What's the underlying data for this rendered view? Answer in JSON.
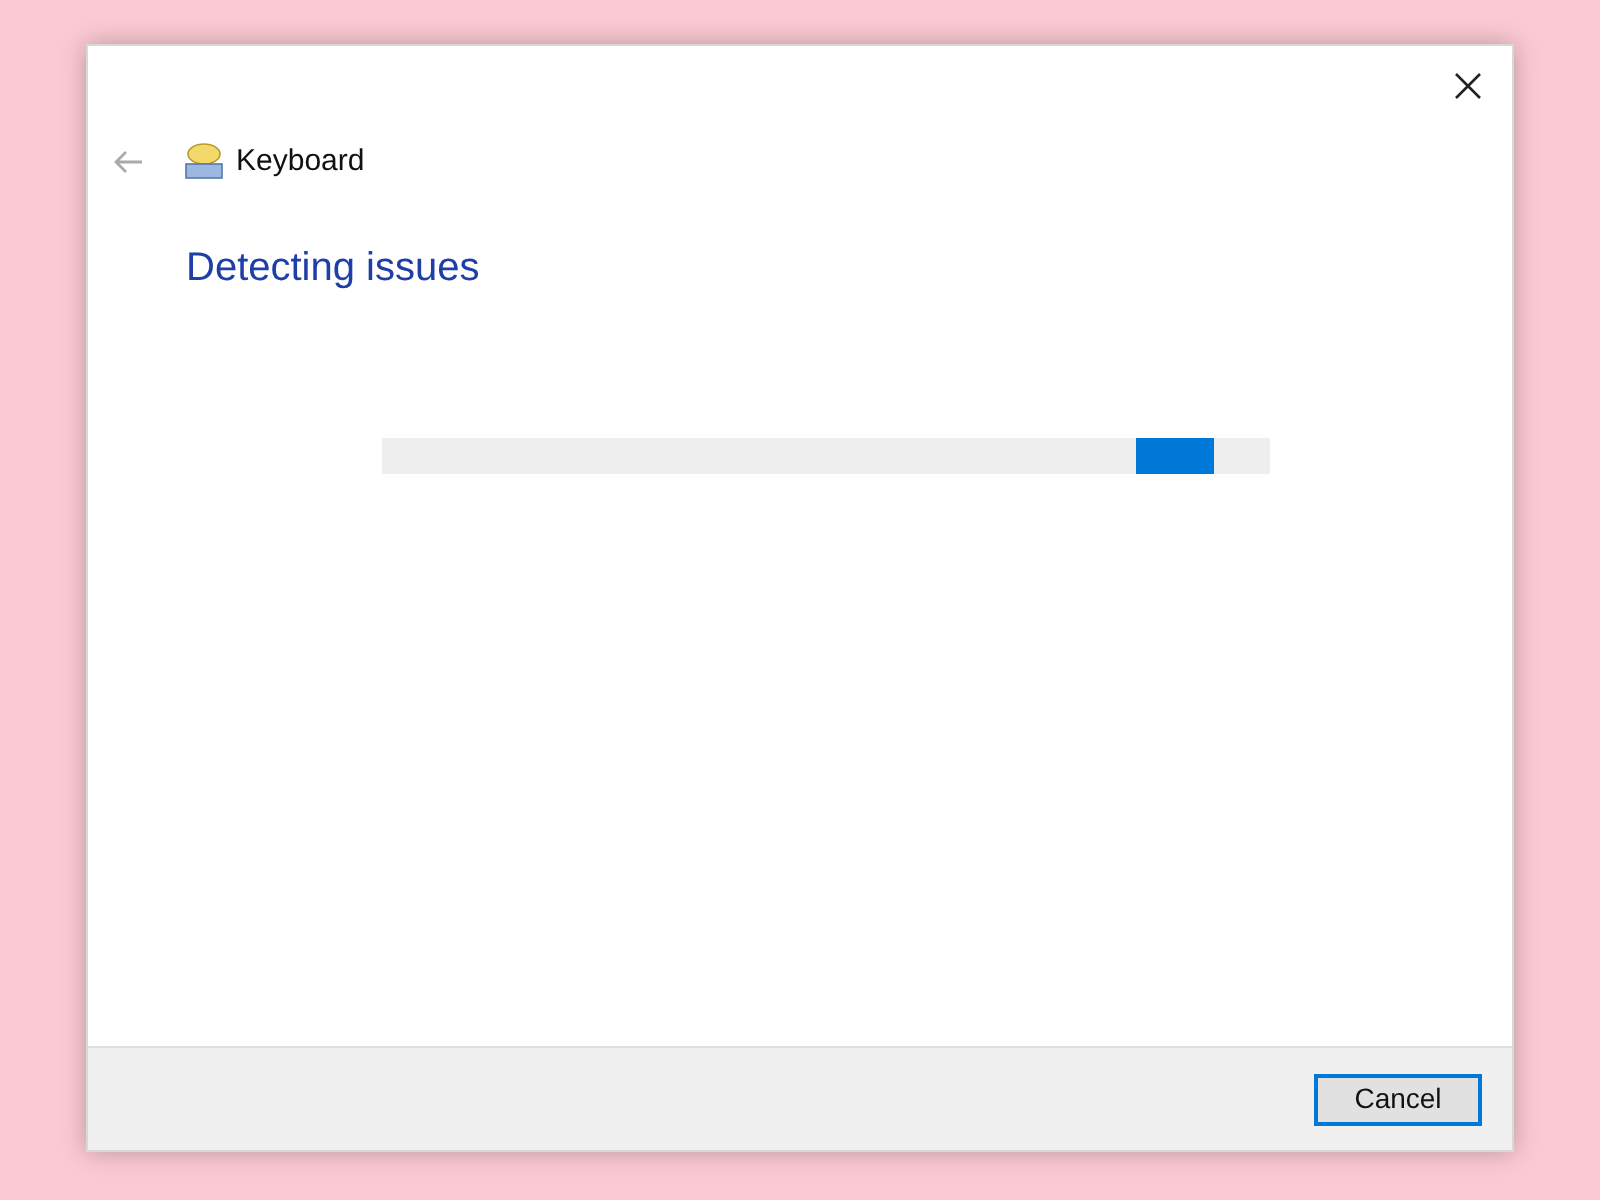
{
  "header": {
    "title": "Keyboard"
  },
  "heading": "Detecting issues",
  "progress": {
    "level": 0.85
  },
  "footer": {
    "button": {
      "label": "Cancel",
      "focused": true
    }
  }
}
